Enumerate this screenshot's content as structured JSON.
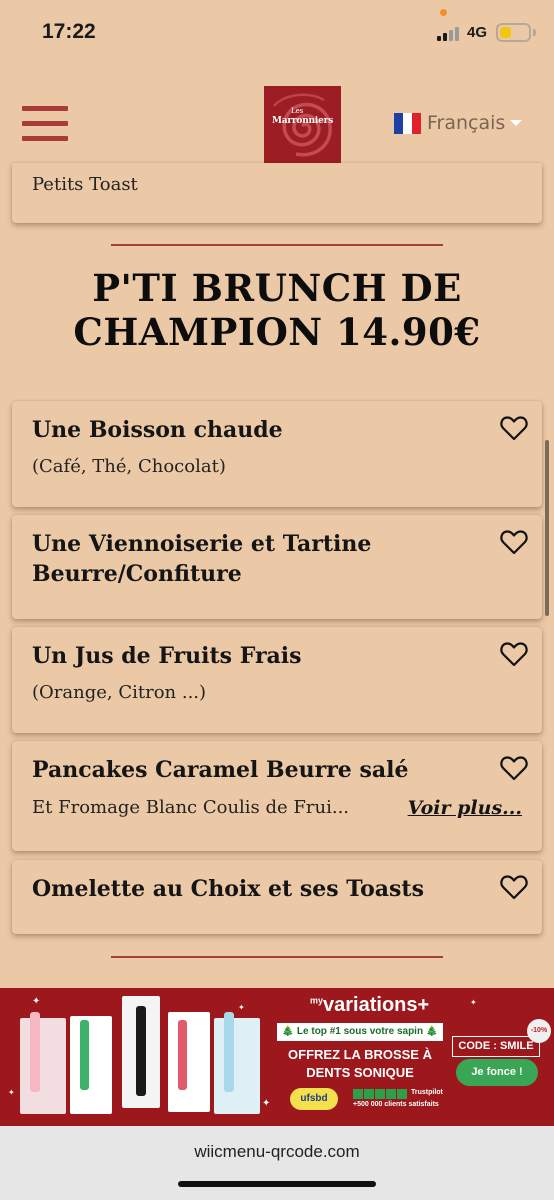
{
  "status": {
    "time": "17:22",
    "network": "4G",
    "battery_level": 0.4
  },
  "header": {
    "logo_small": "Les",
    "logo_text": "Marronniers",
    "language": "Français"
  },
  "previous_item": {
    "desc": "Petits Toast"
  },
  "section": {
    "title_line1": "P'TI BRUNCH DE",
    "title_line2": "CHAMPION 14.90€"
  },
  "items": [
    {
      "title": "Une Boisson chaude",
      "desc": "(Café, Thé, Chocolat)"
    },
    {
      "title": "Une Viennoiserie et Tartine Beurre/Confiture"
    },
    {
      "title": "Un Jus de Fruits Frais",
      "desc": "(Orange, Citron ...)"
    },
    {
      "title": "Pancakes Caramel Beurre salé",
      "desc": "Et Fromage Blanc Coulis de Frui...",
      "more": "Voir plus..."
    },
    {
      "title": "Omelette au Choix et ses Toasts"
    }
  ],
  "ad": {
    "brand_prefix": "my",
    "brand": "variations",
    "tagline": "Le top #1 sous votre sapin",
    "offer_line1": "OFFREZ LA BROSSE À",
    "offer_line2": "DENTS SONIQUE",
    "code": "CODE : SMILE",
    "cta": "Je fonce !",
    "discount": "-10%",
    "ufsbd": "ufsbd",
    "trustpilot": "Trustpilot",
    "clients": "+500 000 clients satisfaits"
  },
  "footer": {
    "url": "wiicmenu-qrcode.com"
  },
  "colors": {
    "background": "#ecc9a6",
    "accent": "#a83a38",
    "ad_background": "#9c181d"
  },
  "icons": {
    "menu": "hamburger-menu-icon",
    "favorite": "heart-outline-icon",
    "flag": "france-flag-icon"
  }
}
